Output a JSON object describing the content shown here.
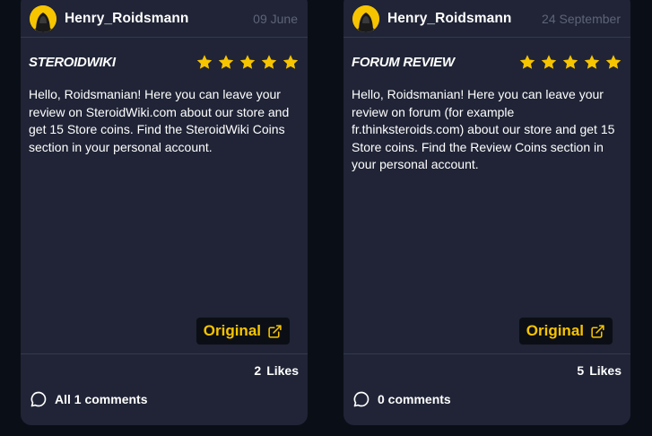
{
  "colors": {
    "accent": "#f7c400",
    "card_bg": "#202436",
    "page_bg": "#0a0e16",
    "muted": "#5e6478"
  },
  "reviews": [
    {
      "author": "Henry_Roidsmann",
      "date": "09 June",
      "title": "SteroidWiki",
      "rating": 5,
      "text": "Hello, Roidsmanian! Here you can leave your review on SteroidWiki.com about our store and get 15 Store coins. Find the SteroidWiki Coins section in your personal account.",
      "original_label": "Original",
      "likes_count": "2",
      "likes_label": "Likes",
      "comments_label": "All 1 comments",
      "icons": {
        "avatar": "hooded-figure-avatar",
        "external": "external-link-icon",
        "comment": "chat-bubble-icon",
        "star": "star-icon"
      }
    },
    {
      "author": "Henry_Roidsmann",
      "date": "24 September",
      "title": "Forum review",
      "rating": 5,
      "text": "Hello, Roidsmanian! Here you can leave your review on forum (for example fr.thinksteroids.com) about our store and get 15 Store coins. Find the Review Coins section in your personal account.",
      "original_label": "Original",
      "likes_count": "5",
      "likes_label": "Likes",
      "comments_label": "0 comments",
      "icons": {
        "avatar": "hooded-figure-avatar",
        "external": "external-link-icon",
        "comment": "chat-bubble-icon",
        "star": "star-icon"
      }
    }
  ]
}
